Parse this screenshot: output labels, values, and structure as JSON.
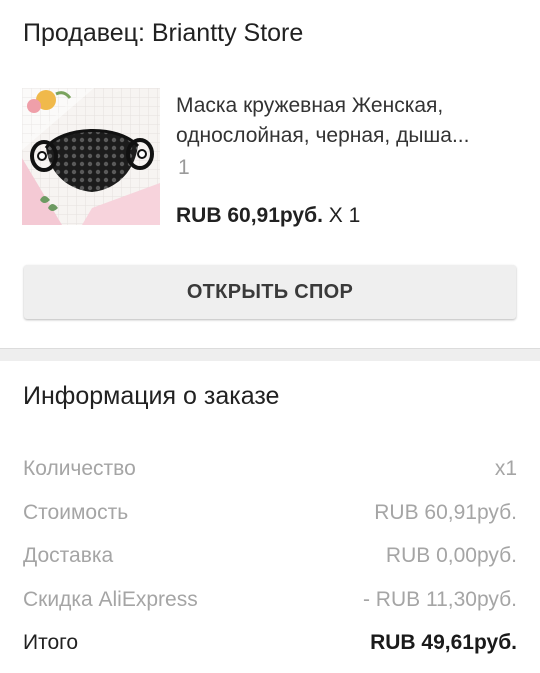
{
  "seller": {
    "label": "Продавец: Briantty Store"
  },
  "product": {
    "image_name": "black-lace-mask-image",
    "title_line1": "Маска кружевная Женская,",
    "title_line2": "однослойная, черная, дыша...",
    "sku": "1",
    "price": "RUB 60,91руб.",
    "quantity": " X 1"
  },
  "actions": {
    "open_dispute": "ОТКРЫТЬ СПОР"
  },
  "order_info": {
    "title": "Информация о заказе",
    "rows": [
      {
        "label": "Количество",
        "value": "x1"
      },
      {
        "label": "Стоимость",
        "value": "RUB 60,91руб."
      },
      {
        "label": "Доставка",
        "value": "RUB 0,00руб."
      },
      {
        "label": "Скидка AliExpress",
        "value": "- RUB 11,30руб."
      },
      {
        "label": "Итого",
        "value": "RUB 49,61руб."
      }
    ]
  },
  "colors": {
    "text_primary": "#212121",
    "text_secondary": "#a5a5a5",
    "button_bg": "#efefef",
    "divider": "#eeeeee"
  }
}
